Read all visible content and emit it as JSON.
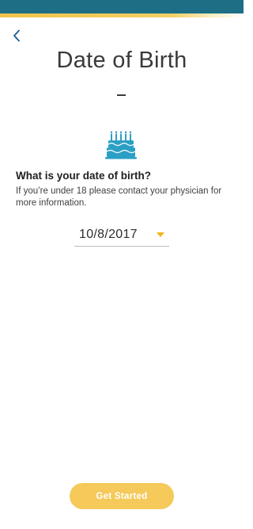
{
  "header": {
    "bar_color": "#1e6f86",
    "accent_color": "#f2c34a",
    "back_icon": "chevron-left-icon"
  },
  "page": {
    "title": "Date of Birth",
    "icon": "birthday-cake-icon",
    "icon_color": "#2b9fc4"
  },
  "form": {
    "question": "What is your date of birth?",
    "helper": "If you’re under 18 please contact your physician for more information.",
    "date_value": "10/8/2017",
    "dropdown_icon": "caret-down-icon",
    "dropdown_color": "#f2b51b"
  },
  "footer": {
    "button_label": "Get Started",
    "button_color": "#f5c95a"
  }
}
